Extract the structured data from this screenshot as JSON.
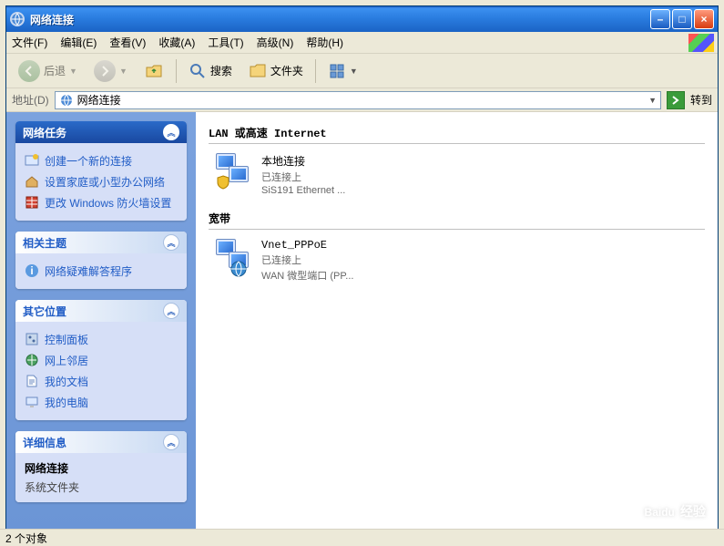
{
  "window": {
    "title": "网络连接"
  },
  "winbuttons": {
    "min": "–",
    "max": "□",
    "close": "×"
  },
  "menu": {
    "file": "文件(F)",
    "edit": "编辑(E)",
    "view": "查看(V)",
    "favorites": "收藏(A)",
    "tools": "工具(T)",
    "advanced": "高级(N)",
    "help": "帮助(H)"
  },
  "toolbar": {
    "back": "后退",
    "search": "搜索",
    "folders": "文件夹"
  },
  "address": {
    "label": "地址(D)",
    "value": "网络连接",
    "go": "转到"
  },
  "sidebar": {
    "tasks": {
      "title": "网络任务",
      "items": [
        "创建一个新的连接",
        "设置家庭或小型办公网络",
        "更改 Windows 防火墙设置"
      ]
    },
    "related": {
      "title": "相关主题",
      "items": [
        "网络疑难解答程序"
      ]
    },
    "other": {
      "title": "其它位置",
      "items": [
        "控制面板",
        "网上邻居",
        "我的文档",
        "我的电脑"
      ]
    },
    "details": {
      "title": "详细信息",
      "name": "网络连接",
      "type": "系统文件夹"
    }
  },
  "sections": {
    "lan": {
      "title": "LAN 或高速 Internet",
      "item": {
        "name": "本地连接",
        "status": "已连接上",
        "device": "SiS191 Ethernet ..."
      }
    },
    "broadband": {
      "title": "宽带",
      "item": {
        "name": "Vnet_PPPoE",
        "status": "已连接上",
        "device": "WAN 微型端口 (PP..."
      }
    }
  },
  "statusbar": "2 个对象",
  "watermark": {
    "brand": "Baidu",
    "sub": "经验"
  }
}
